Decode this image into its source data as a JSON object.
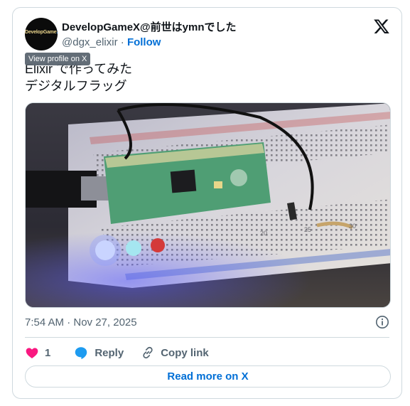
{
  "author": {
    "display_name": "DevelopGameX@前世はymnでした",
    "handle": "@dgx_elixir",
    "separator": "·",
    "follow_label": "Follow",
    "avatar_text_main": "DevelopGame",
    "avatar_text_accent": "X"
  },
  "tooltip": "View profile on X",
  "tweet": {
    "text": "Elixir で作ってみた\nデジタルフラッグ"
  },
  "media": {
    "breadboard_numbers": [
      "20",
      "25",
      "30"
    ]
  },
  "meta": {
    "timestamp": "7:54 AM · Nov 27, 2025"
  },
  "actions": {
    "like_count": "1",
    "reply_label": "Reply",
    "copy_label": "Copy link"
  },
  "read_more_label": "Read more on X",
  "colors": {
    "link": "#006fd6",
    "like": "#f91880",
    "reply": "#1d9bf0",
    "border": "#cfd9de",
    "muted": "#536471"
  }
}
